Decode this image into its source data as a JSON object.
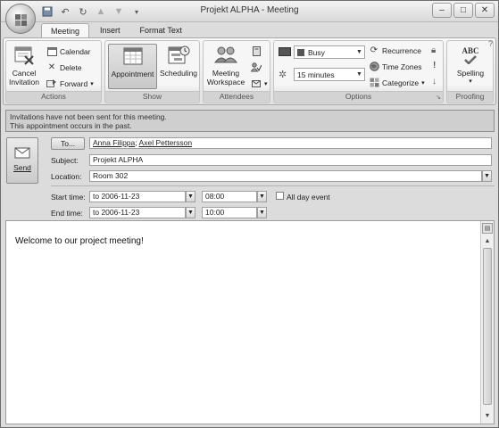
{
  "window": {
    "title": "Projekt ALPHA - Meeting",
    "buttons": [
      "–",
      "□",
      "✕"
    ]
  },
  "qat": {
    "undo_icon": "undo-icon",
    "save_icon": "save-icon"
  },
  "tabs": [
    {
      "label": "Meeting",
      "active": true
    },
    {
      "label": "Insert",
      "active": false
    },
    {
      "label": "Format Text",
      "active": false
    }
  ],
  "ribbon": {
    "actions": {
      "label": "Actions",
      "cancel_line1": "Cancel",
      "cancel_line2": "Invitation",
      "calendar": "Calendar",
      "delete": "Delete",
      "forward": "Forward"
    },
    "show": {
      "label": "Show",
      "appointment": "Appointment",
      "scheduling": "Scheduling"
    },
    "attendees": {
      "label": "Attendees",
      "workspace_line1": "Meeting",
      "workspace_line2": "Workspace"
    },
    "options": {
      "label": "Options",
      "show_as": "Busy",
      "reminder": "15 minutes",
      "recurrence": "Recurrence",
      "time_zones": "Time Zones",
      "categorize": "Categorize"
    },
    "proofing": {
      "label": "Proofing",
      "spelling": "Spelling",
      "abc": "ABC"
    }
  },
  "infobar": {
    "line1": "Invitations have not been sent for this meeting.",
    "line2": "This appointment occurs in the past."
  },
  "form": {
    "send_label": "Send",
    "to_button": "To...",
    "to_recipient1": "Anna Filippa",
    "to_separator": ";",
    "to_recipient2": "Axel Pettersson",
    "subject_label": "Subject:",
    "subject_value": "Projekt ALPHA",
    "location_label": "Location:",
    "location_value": "Room 302",
    "start_label": "Start time:",
    "start_date": "to 2006-11-23",
    "start_time": "08:00",
    "allday_label": "All day event",
    "end_label": "End time:",
    "end_date": "to 2006-11-23",
    "end_time": "10:00"
  },
  "body": {
    "text": "Welcome to our project meeting!"
  }
}
